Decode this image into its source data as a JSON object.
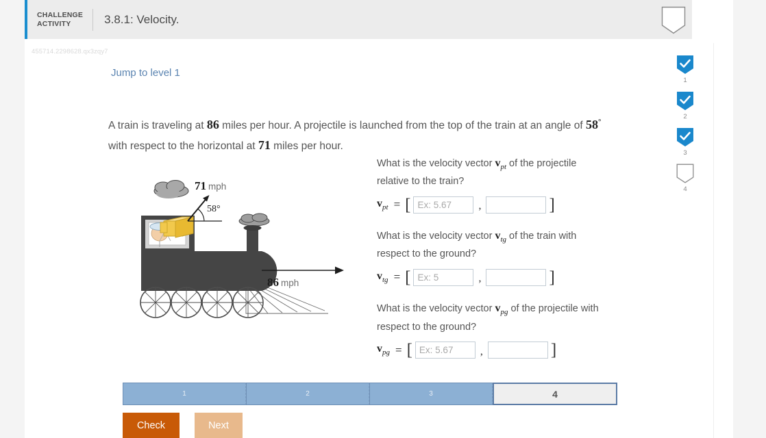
{
  "header": {
    "challenge_line1": "CHALLENGE",
    "challenge_line2": "ACTIVITY",
    "title": "3.8.1: Velocity.",
    "accent_color": "#1a8ecf",
    "shield_icon": "shield-outline-icon"
  },
  "question_id": "455714.2298628.qx3zqy7",
  "jump_link": "Jump to level 1",
  "prompt": {
    "part1": "A train is traveling at ",
    "speed_train": "86",
    "part2": " miles per hour. A projectile is launched from the top of the train at an angle of ",
    "angle": "58",
    "degree": "°",
    "part3": " with respect to the horizontal at ",
    "speed_projectile": "71",
    "part4": " miles per hour."
  },
  "diagram": {
    "projectile_label": "71",
    "projectile_unit": "mph",
    "angle_label": "58°",
    "train_label": "86",
    "train_unit": "mph"
  },
  "questions": [
    {
      "text_before": "What is the velocity vector ",
      "vector": "v",
      "subscript": "pt",
      "text_after": " of the projectile relative to the train?",
      "placeholder_x": "Ex: 5.67",
      "placeholder_y": "",
      "value_x": "",
      "value_y": "",
      "open_bracket": "[",
      "close_bracket": "]",
      "equals": "=",
      "comma": ","
    },
    {
      "text_before": "What is the velocity vector ",
      "vector": "v",
      "subscript": "tg",
      "text_after": " of the train with respect to the ground?",
      "placeholder_x": "Ex: 5",
      "placeholder_y": "",
      "value_x": "",
      "value_y": "",
      "open_bracket": "[",
      "close_bracket": "]",
      "equals": "=",
      "comma": ","
    },
    {
      "text_before": "What is the velocity vector ",
      "vector": "v",
      "subscript": "pg",
      "text_after": " of the projectile with respect to the ground?",
      "placeholder_x": "Ex: 5.67",
      "placeholder_y": "",
      "value_x": "",
      "value_y": "",
      "open_bracket": "[",
      "close_bracket": "]",
      "equals": "=",
      "comma": ","
    }
  ],
  "progress": {
    "steps": [
      {
        "label": "1",
        "state": "done"
      },
      {
        "label": "2",
        "state": "done"
      },
      {
        "label": "3",
        "state": "done"
      },
      {
        "label": "4",
        "state": "active"
      }
    ]
  },
  "buttons": {
    "check": "Check",
    "next": "Next",
    "check_color": "#c85a07",
    "next_color": "#e8b98c"
  },
  "sidebar": {
    "items": [
      {
        "label": "1",
        "state": "checked",
        "icon": "shield-check-icon"
      },
      {
        "label": "2",
        "state": "checked",
        "icon": "shield-check-icon"
      },
      {
        "label": "3",
        "state": "checked",
        "icon": "shield-check-icon"
      },
      {
        "label": "4",
        "state": "empty",
        "icon": "shield-outline-icon"
      }
    ],
    "checked_color": "#1a88cc"
  }
}
